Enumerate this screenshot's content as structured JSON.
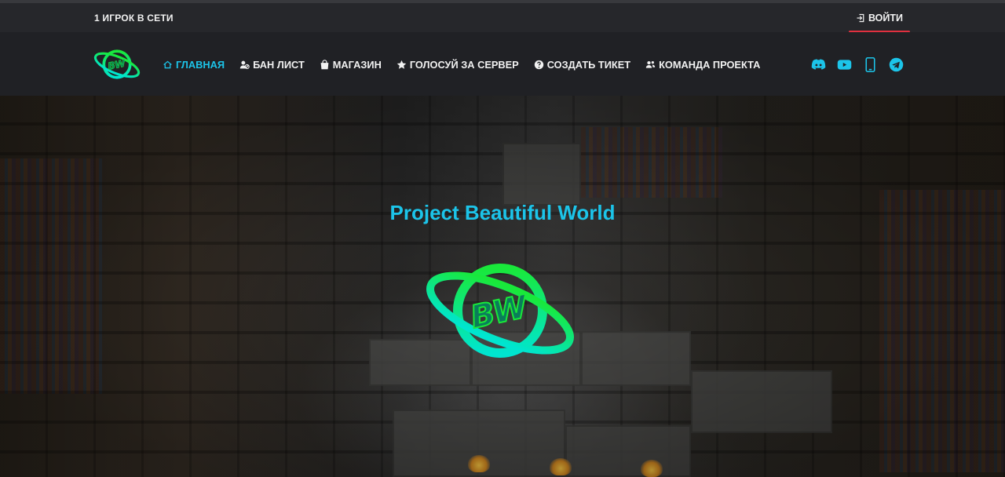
{
  "topbar": {
    "online_text": "1 ИГРОК В СЕТИ",
    "login_label": "ВОЙТИ"
  },
  "nav": {
    "logo_text": "BW",
    "items": [
      {
        "label": "ГЛАВНАЯ",
        "icon": "home-icon",
        "active": true
      },
      {
        "label": "БАН ЛИСТ",
        "icon": "user-ban-icon",
        "active": false
      },
      {
        "label": "МАГАЗИН",
        "icon": "shopping-bag-icon",
        "active": false
      },
      {
        "label": "ГОЛОСУЙ ЗА СЕРВЕР",
        "icon": "star-icon",
        "active": false
      },
      {
        "label": "СОЗДАТЬ ТИКЕТ",
        "icon": "question-circle-icon",
        "active": false
      },
      {
        "label": "КОМАНДА ПРОЕКТА",
        "icon": "users-icon",
        "active": false
      }
    ],
    "socials": [
      "discord-icon",
      "youtube-icon",
      "mobile-icon",
      "telegram-icon"
    ]
  },
  "hero": {
    "title": "Project Beautiful World",
    "logo_text": "BW"
  },
  "colors": {
    "accent": "#1cc4e9",
    "login_underline": "#e0303f",
    "logo_green": "#19e83a",
    "logo_cyan": "#00e5d0"
  }
}
